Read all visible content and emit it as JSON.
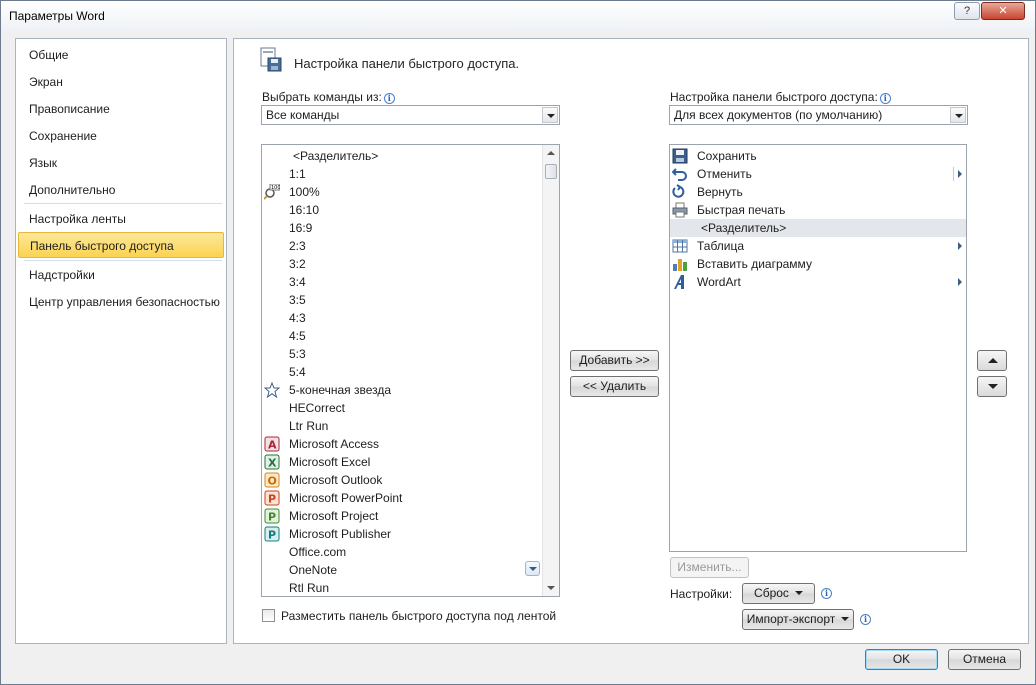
{
  "window": {
    "title": "Параметры Word",
    "help_label": "?",
    "close_label": "✕"
  },
  "sidebar": {
    "items": [
      {
        "label": "Общие"
      },
      {
        "label": "Экран"
      },
      {
        "label": "Правописание"
      },
      {
        "label": "Сохранение"
      },
      {
        "label": "Язык"
      },
      {
        "label": "Дополнительно"
      },
      {
        "label": "Настройка ленты"
      },
      {
        "label": "Панель быстрого доступа",
        "selected": true
      },
      {
        "label": "Надстройки"
      },
      {
        "label": "Центр управления безопасностью"
      }
    ]
  },
  "main": {
    "heading": "Настройка панели быстрого доступа.",
    "choose_label": "Выбрать команды из:",
    "choose_value": "Все команды",
    "customize_label": "Настройка панели быстрого доступа:",
    "customize_value": "Для всех документов (по умолчанию)",
    "commands": [
      {
        "label": "<Разделитель>",
        "icon": "separator"
      },
      {
        "label": "1:1",
        "icon": "none"
      },
      {
        "label": "100%",
        "icon": "zoom-100-icon"
      },
      {
        "label": "16:10",
        "icon": "none"
      },
      {
        "label": "16:9",
        "icon": "none"
      },
      {
        "label": "2:3",
        "icon": "none"
      },
      {
        "label": "3:2",
        "icon": "none"
      },
      {
        "label": "3:4",
        "icon": "none"
      },
      {
        "label": "3:5",
        "icon": "none"
      },
      {
        "label": "4:3",
        "icon": "none"
      },
      {
        "label": "4:5",
        "icon": "none"
      },
      {
        "label": "5:3",
        "icon": "none"
      },
      {
        "label": "5:4",
        "icon": "none"
      },
      {
        "label": "5-конечная звезда",
        "icon": "star-icon"
      },
      {
        "label": "HECorrect",
        "icon": "none"
      },
      {
        "label": "Ltr Run",
        "icon": "none"
      },
      {
        "label": "Microsoft Access",
        "icon": "access-icon"
      },
      {
        "label": "Microsoft Excel",
        "icon": "excel-icon"
      },
      {
        "label": "Microsoft Outlook",
        "icon": "outlook-icon"
      },
      {
        "label": "Microsoft PowerPoint",
        "icon": "powerpoint-icon"
      },
      {
        "label": "Microsoft Project",
        "icon": "project-icon"
      },
      {
        "label": "Microsoft Publisher",
        "icon": "publisher-icon"
      },
      {
        "label": "Office.com",
        "icon": "none"
      },
      {
        "label": "OneNote",
        "icon": "none"
      },
      {
        "label": "Rtl Run",
        "icon": "none"
      }
    ],
    "toolbar_items": [
      {
        "label": "Сохранить",
        "icon": "save-icon"
      },
      {
        "label": "Отменить",
        "icon": "undo-icon",
        "has_submenu": true,
        "split": true
      },
      {
        "label": "Вернуть",
        "icon": "redo-icon"
      },
      {
        "label": "Быстрая печать",
        "icon": "quick-print-icon"
      },
      {
        "label": "<Разделитель>",
        "icon": "separator",
        "highlighted": true
      },
      {
        "label": "Таблица",
        "icon": "table-icon",
        "has_submenu": true
      },
      {
        "label": "Вставить диаграмму",
        "icon": "chart-icon"
      },
      {
        "label": "WordArt",
        "icon": "wordart-icon",
        "has_submenu": true
      }
    ],
    "add_label": "Добавить >>",
    "remove_label": "<< Удалить",
    "modify_label": "Изменить...",
    "settings_label": "Настройки:",
    "reset_label": "Сброс",
    "import_export_label": "Импорт-экспорт",
    "checkbox_label": "Разместить панель быстрого доступа под лентой",
    "checkbox_checked": false
  },
  "footer": {
    "ok_label": "OK",
    "cancel_label": "Отмена"
  },
  "colors": {
    "selected_nav": "#fbd352",
    "accent": "#2a63b0"
  }
}
